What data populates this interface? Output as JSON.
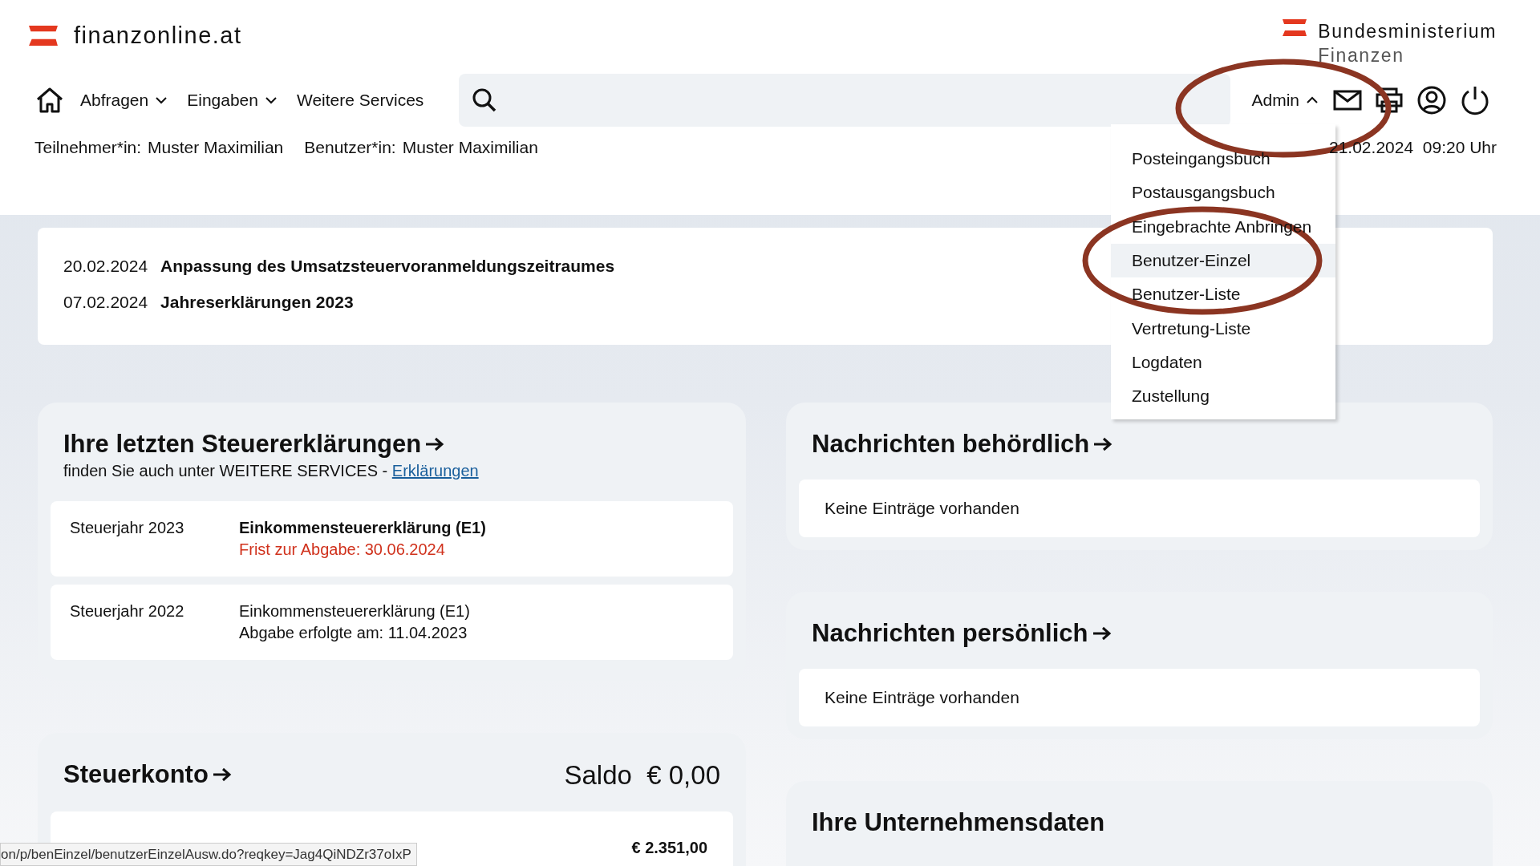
{
  "header": {
    "logo": "finanzonline.at",
    "ministry": [
      "Bundesministerium",
      "Finanzen"
    ]
  },
  "nav": {
    "items": [
      {
        "label": "Abfragen",
        "dropdown": true
      },
      {
        "label": "Eingaben",
        "dropdown": true
      },
      {
        "label": "Weitere Services",
        "dropdown": false
      }
    ],
    "admin": {
      "label": "Admin",
      "expanded": true,
      "highlighted": true
    }
  },
  "admin_menu": [
    {
      "label": "Posteingangsbuch",
      "selected": false,
      "highlighted": false
    },
    {
      "label": "Postausgangsbuch",
      "selected": false,
      "highlighted": false
    },
    {
      "label": "Eingebrachte Anbringen",
      "selected": false,
      "highlighted": false
    },
    {
      "label": "Benutzer-Einzel",
      "selected": true,
      "highlighted": true
    },
    {
      "label": "Benutzer-Liste",
      "selected": false,
      "highlighted": false
    },
    {
      "label": "Vertretung-Liste",
      "selected": false,
      "highlighted": false
    },
    {
      "label": "Logdaten",
      "selected": false,
      "highlighted": false
    },
    {
      "label": "Zustellung",
      "selected": false,
      "highlighted": false
    }
  ],
  "info": {
    "participant_label": "Teilnehmer*in:",
    "participant": "Muster Maximilian",
    "user_label": "Benutzer*in:",
    "user": "Muster Maximilian",
    "datetime": "21.02.2024  09:20 Uhr"
  },
  "news": [
    {
      "date": "20.02.2024",
      "title": "Anpassung des Umsatzsteuervoranmeldungszeitraumes"
    },
    {
      "date": "07.02.2024",
      "title": "Jahreserklärungen 2023"
    }
  ],
  "declarations": {
    "title": "Ihre letzten Steuererklärungen",
    "subtitle": "finden Sie auch unter WEITERE SERVICES - ",
    "link": "Erklärungen",
    "items": [
      {
        "year": "Steuerjahr 2023",
        "name": "Einkommensteuererklärung (E1)",
        "status": "Frist zur Abgabe: 30.06.2024",
        "open": true
      },
      {
        "year": "Steuerjahr 2022",
        "name": "Einkommensteuererklärung (E1)",
        "status": "Abgabe erfolgte am: 11.04.2023",
        "open": false
      }
    ]
  },
  "account": {
    "title": "Steuerkonto",
    "balance_label": "Saldo",
    "balance": "€ 0,00",
    "rows": [
      {
        "amount": "€ 2.351,00"
      }
    ]
  },
  "messages": [
    {
      "title": "Nachrichten behördlich",
      "arrow": true,
      "empty": "Keine Einträge vorhanden"
    },
    {
      "title": "Nachrichten persönlich",
      "arrow": true,
      "empty": "Keine Einträge vorhanden"
    },
    {
      "title": "Ihre Unternehmensdaten",
      "arrow": false
    }
  ],
  "status_bar": {
    "url": "on/p/benEinzel/benutzerEinzelAusw.do?reqkey=Jag4QiNDZr37oIxP"
  }
}
